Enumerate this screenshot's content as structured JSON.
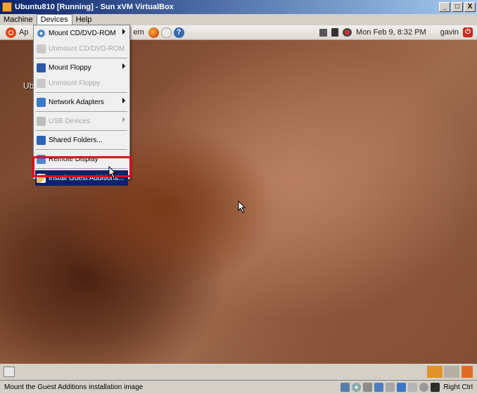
{
  "window": {
    "title": "Ubuntu810 [Running] - Sun xVM VirtualBox",
    "minimize": "_",
    "maximize": "□",
    "close": "X"
  },
  "menubar": {
    "items": [
      "Machine",
      "Devices",
      "Help"
    ]
  },
  "guest": {
    "panel": {
      "applications_partial": "Ap",
      "system_partial": "em",
      "clock": "Mon Feb  9,  8:32 PM",
      "user": "gavin"
    },
    "desktop_label_partial": "Ub"
  },
  "devices_menu": {
    "items": [
      {
        "label": "Mount CD/DVD-ROM",
        "enabled": true,
        "submenu": true,
        "icon": "cd-icon"
      },
      {
        "label": "Unmount CD/DVD-ROM",
        "enabled": false,
        "submenu": false,
        "icon": "cd-unmount-icon"
      },
      {
        "label": "Mount Floppy",
        "enabled": true,
        "submenu": true,
        "icon": "floppy-icon"
      },
      {
        "label": "Unmount Floppy",
        "enabled": false,
        "submenu": false,
        "icon": "floppy-unmount-icon"
      },
      {
        "label": "Network Adapters",
        "enabled": true,
        "submenu": true,
        "icon": "network-icon"
      },
      {
        "label": "USB Devices",
        "enabled": false,
        "submenu": true,
        "icon": "usb-icon"
      },
      {
        "label": "Shared Folders...",
        "enabled": true,
        "submenu": false,
        "icon": "shared-folders-icon"
      },
      {
        "label": "Remote Display",
        "enabled": true,
        "submenu": false,
        "icon": "remote-display-icon"
      },
      {
        "label": "Install Guest Additions...",
        "enabled": true,
        "submenu": false,
        "icon": "guest-additions-icon",
        "highlighted": true
      }
    ]
  },
  "statusbar": {
    "message": "Mount the Guest Additions installation image",
    "host_key": "Right Ctrl"
  },
  "colors": {
    "title_bar": "#0a246a",
    "highlight": "#0a246a",
    "annotation_box": "#e3001b"
  }
}
